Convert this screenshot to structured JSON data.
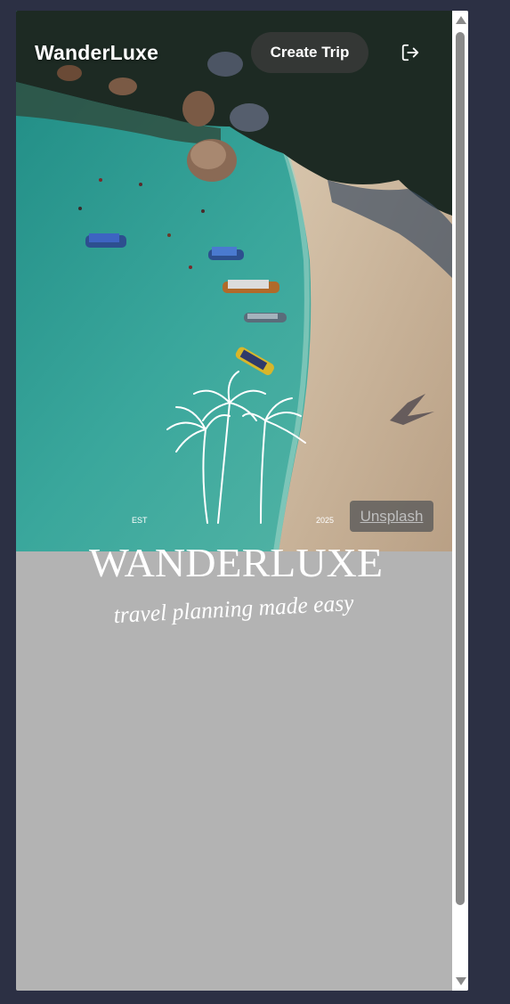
{
  "app": {
    "brand": "WanderLuxe",
    "create_trip_label": "Create Trip",
    "logout_icon": "logout-icon"
  },
  "hero": {
    "photo_credit": "Unsplash",
    "logo": {
      "est_label": "EST",
      "year": "2025",
      "wordmark": "WANDERLUXE",
      "tagline": "travel planning made easy"
    }
  },
  "colors": {
    "page_bg": "#2c3044",
    "content_bg": "#b3b3b3",
    "sea": "#3fa59b",
    "sand": "#c9b39a",
    "button_bg": "#3c3c3c"
  }
}
